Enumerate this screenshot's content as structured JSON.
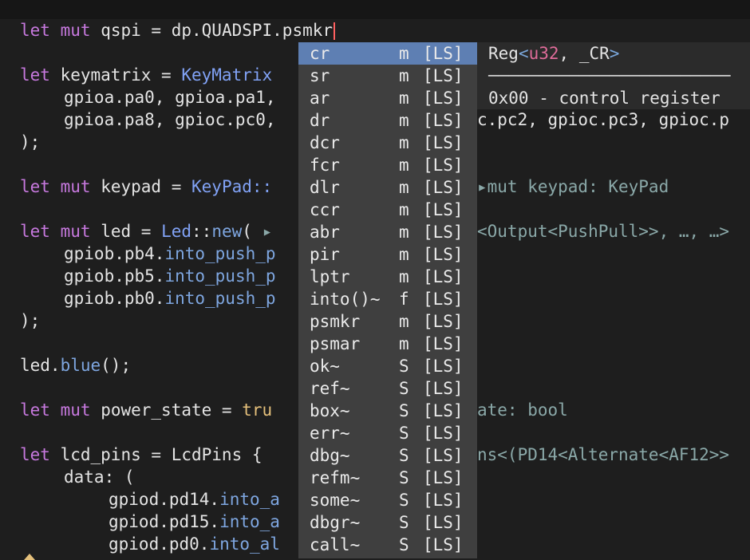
{
  "editor": {
    "l1": {
      "kw1": "let",
      "kw2": "mut",
      "name": "qspi",
      "eq": "=",
      "expr": "dp.QUADSPI.psmkr"
    },
    "l2": {
      "kw": "let",
      "name": "keymatrix",
      "eq": "=",
      "type": "KeyMatrix"
    },
    "l3": "gpioa.pa0, gpioa.pa1,",
    "l4": "gpioa.pa8, gpioc.pc0,",
    "l5": ");",
    "l6": {
      "kw1": "let",
      "kw2": "mut",
      "name": "keypad",
      "eq": "=",
      "type": "KeyPad::"
    },
    "l7": {
      "kw1": "let",
      "kw2": "mut",
      "name": "led",
      "eq": "=",
      "type": "Led",
      "sep": "::",
      "fn": "new",
      "paren": "(",
      "marker": "▸"
    },
    "l8": {
      "obj": "gpiob.pb4.",
      "fn": "into_push_p"
    },
    "l9": {
      "obj": "gpiob.pb5.",
      "fn": "into_push_p"
    },
    "l10": {
      "obj": "gpiob.pb0.",
      "fn": "into_push_p"
    },
    "l11": ");",
    "l12": {
      "obj": "led.",
      "fn": "blue",
      "rest": "();"
    },
    "l13": {
      "kw1": "let",
      "kw2": "mut",
      "name": "power_state",
      "eq": "=",
      "val": "tru"
    },
    "l14": {
      "kw": "let",
      "name": "lcd_pins",
      "eq": "=",
      "type": "LcdPins",
      "brace": "{"
    },
    "l15": "data: (",
    "l16": {
      "obj": "gpiod.pd14.",
      "fn": "into_a"
    },
    "l17": {
      "obj": "gpiod.pd15.",
      "fn": "into_a"
    },
    "l18": {
      "obj": "gpiod.pd0.",
      "fn": "into_al"
    }
  },
  "hints": {
    "keymatrix_rest": "c.pc2, gpioc.pc3, gpioc.p",
    "keypad": "▸mut keypad: KeyPad",
    "led": "<Output<PushPull>>, …, …>",
    "power_state": "ate: bool",
    "lcd_pins": "ns<(PD14<Alternate<AF12>>"
  },
  "completion": {
    "items": [
      {
        "label": "cr",
        "kind": "m",
        "source": "[LS]",
        "selected": true
      },
      {
        "label": "sr",
        "kind": "m",
        "source": "[LS]"
      },
      {
        "label": "ar",
        "kind": "m",
        "source": "[LS]"
      },
      {
        "label": "dr",
        "kind": "m",
        "source": "[LS]"
      },
      {
        "label": "dcr",
        "kind": "m",
        "source": "[LS]"
      },
      {
        "label": "fcr",
        "kind": "m",
        "source": "[LS]"
      },
      {
        "label": "dlr",
        "kind": "m",
        "source": "[LS]"
      },
      {
        "label": "ccr",
        "kind": "m",
        "source": "[LS]"
      },
      {
        "label": "abr",
        "kind": "m",
        "source": "[LS]"
      },
      {
        "label": "pir",
        "kind": "m",
        "source": "[LS]"
      },
      {
        "label": "lptr",
        "kind": "m",
        "source": "[LS]"
      },
      {
        "label": "into()~",
        "kind": "f",
        "source": "[LS]"
      },
      {
        "label": "psmkr",
        "kind": "m",
        "source": "[LS]"
      },
      {
        "label": "psmar",
        "kind": "m",
        "source": "[LS]"
      },
      {
        "label": "ok~",
        "kind": "S",
        "source": "[LS]"
      },
      {
        "label": "ref~",
        "kind": "S",
        "source": "[LS]"
      },
      {
        "label": "box~",
        "kind": "S",
        "source": "[LS]"
      },
      {
        "label": "err~",
        "kind": "S",
        "source": "[LS]"
      },
      {
        "label": "dbg~",
        "kind": "S",
        "source": "[LS]"
      },
      {
        "label": "refm~",
        "kind": "S",
        "source": "[LS]"
      },
      {
        "label": "some~",
        "kind": "S",
        "source": "[LS]"
      },
      {
        "label": "dbgr~",
        "kind": "S",
        "source": "[LS]"
      },
      {
        "label": "call~",
        "kind": "S",
        "source": "[LS]"
      }
    ]
  },
  "doc": {
    "sig_prefix": "Reg",
    "sig_lt": "<",
    "sig_type": "u32",
    "sig_rest": ", _CR",
    "sig_gt": ">",
    "rule": "────────────────────────",
    "desc": "0x00 - control register"
  },
  "colors": {
    "keyword": "#c678dd",
    "type": "#81a2f5",
    "popup_bg": "#3f3f3f",
    "selected": "#5e7fb3",
    "cursor": "#ff5f5f"
  }
}
